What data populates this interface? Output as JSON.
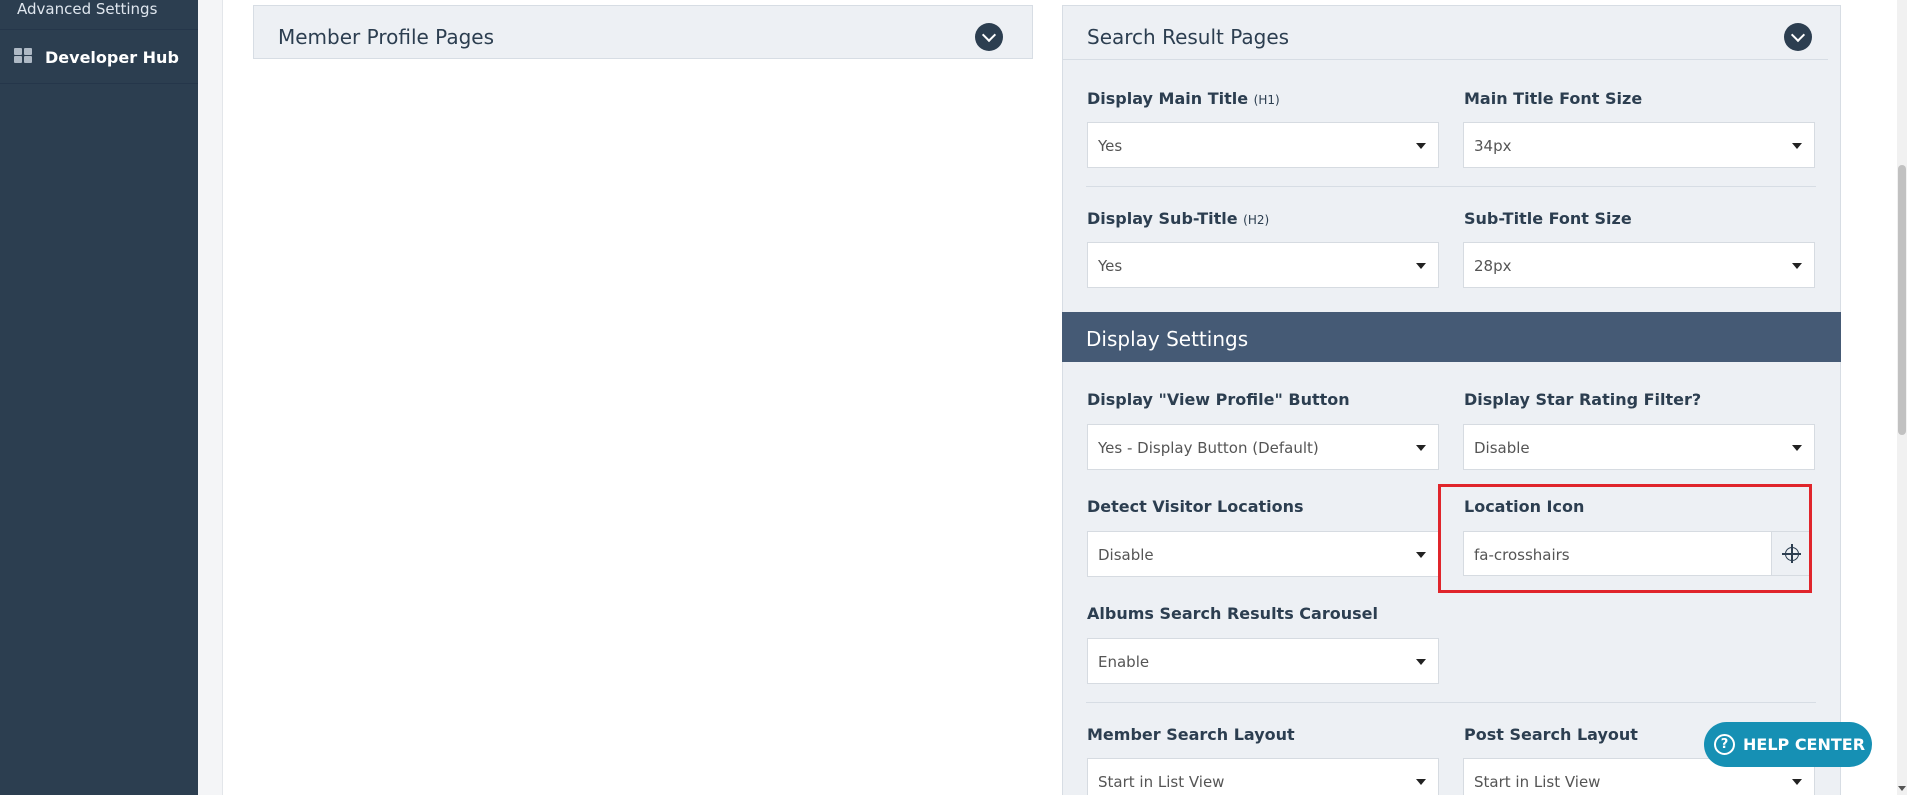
{
  "sidebar": {
    "items": [
      {
        "label": "Advanced Settings"
      },
      {
        "label": "Developer Hub"
      }
    ]
  },
  "panels": {
    "member_profile": {
      "title": "Member Profile Pages"
    },
    "search_results": {
      "title": "Search Result Pages"
    }
  },
  "fields": {
    "display_main_title": {
      "label": "Display Main Title",
      "hint": "(H1)",
      "value": "Yes"
    },
    "main_title_font_size": {
      "label": "Main Title Font Size",
      "value": "34px"
    },
    "display_sub_title": {
      "label": "Display Sub-Title",
      "hint": "(H2)",
      "value": "Yes"
    },
    "sub_title_font_size": {
      "label": "Sub-Title Font Size",
      "value": "28px"
    }
  },
  "display_settings": {
    "title": "Display Settings",
    "view_profile_button": {
      "label": "Display \"View Profile\" Button",
      "value": "Yes - Display Button (Default)"
    },
    "star_rating_filter": {
      "label": "Display Star Rating Filter?",
      "value": "Disable"
    },
    "detect_visitor_locations": {
      "label": "Detect Visitor Locations",
      "value": "Disable"
    },
    "location_icon": {
      "label": "Location Icon",
      "value": "fa-crosshairs"
    },
    "albums_carousel": {
      "label": "Albums Search Results Carousel",
      "value": "Enable"
    },
    "member_search_layout": {
      "label": "Member Search Layout",
      "value": "Start in List View"
    },
    "post_search_layout": {
      "label": "Post Search Layout",
      "value": "Start in List View"
    }
  },
  "help_center": {
    "label": "HELP CENTER"
  },
  "colors": {
    "sidebar_bg": "#2c3e50",
    "section_bar_bg": "#455a75",
    "help_bg": "#1690b4",
    "highlight": "#e0252b"
  },
  "icons": [
    "grid-icon",
    "chevron-down-icon",
    "crosshairs-icon",
    "question-circle-icon",
    "caret-down-icon"
  ]
}
